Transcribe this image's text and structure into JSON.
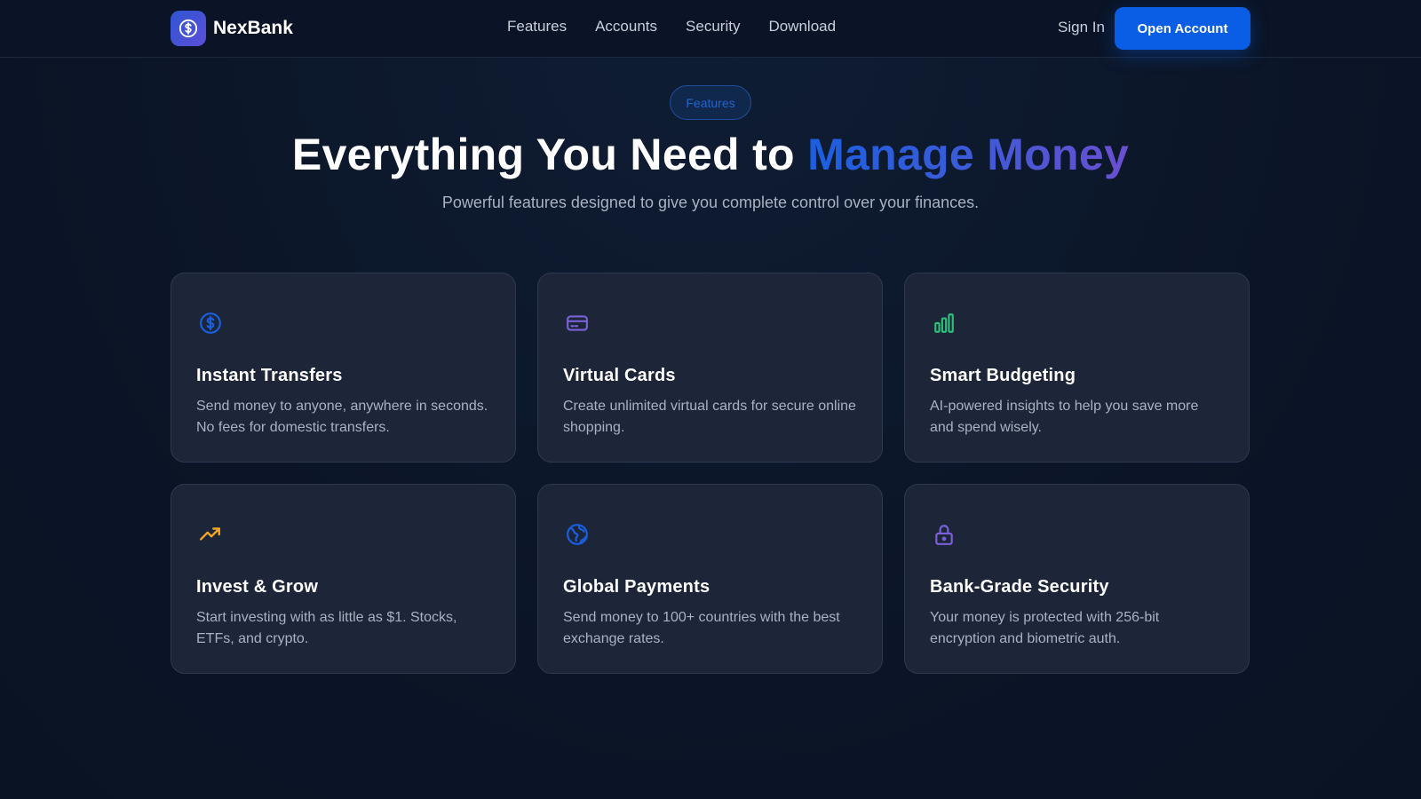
{
  "nav": {
    "brand": "NexBank",
    "links": [
      "Features",
      "Accounts",
      "Security",
      "Download"
    ],
    "sign_in": "Sign In",
    "cta": "Open Account"
  },
  "hero": {
    "pill": "Features",
    "title_start": "Everything You Need to ",
    "title_accent": "Manage Money",
    "subtitle": "Powerful features designed to give you complete control over your finances."
  },
  "features": [
    {
      "icon": "dollar-circle-icon",
      "color": "#1a5fe0",
      "title": "Instant Transfers",
      "description": "Send money to anyone, anywhere in seconds. No fees for domestic transfers."
    },
    {
      "icon": "credit-card-icon",
      "color": "#7b61d9",
      "title": "Virtual Cards",
      "description": "Create unlimited virtual cards for secure online shopping."
    },
    {
      "icon": "bar-chart-icon",
      "color": "#2fbf7a",
      "title": "Smart Budgeting",
      "description": "AI-powered insights to help you save more and spend wisely."
    },
    {
      "icon": "trending-up-icon",
      "color": "#f5a623",
      "title": "Invest & Grow",
      "description": "Start investing with as little as $1. Stocks, ETFs, and crypto."
    },
    {
      "icon": "globe-icon",
      "color": "#1a5fe0",
      "title": "Global Payments",
      "description": "Send money to 100+ countries with the best exchange rates."
    },
    {
      "icon": "lock-icon",
      "color": "#7b61d9",
      "title": "Bank-Grade Security",
      "description": "Your money is protected with 256-bit encryption and biometric auth."
    }
  ]
}
